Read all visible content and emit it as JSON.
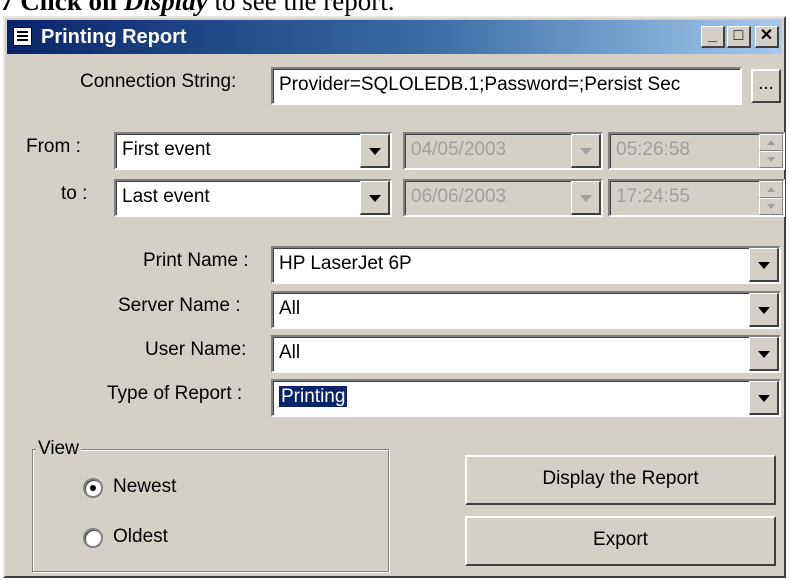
{
  "caption": {
    "prefix": "7 Click on",
    "emphasis": "Display",
    "suffix": "to see the report."
  },
  "window": {
    "title": "Printing Report",
    "minimize": "_",
    "maximize": "□",
    "close": "✕"
  },
  "connection": {
    "label": "Connection String:",
    "value": "Provider=SQLOLEDB.1;Password=;Persist Sec",
    "browse_label": "..."
  },
  "from": {
    "label": "From :",
    "event": "First event",
    "date": "04/05/2003",
    "time": "05:26:58"
  },
  "to": {
    "label": "to :",
    "event": "Last event",
    "date": "06/06/2003",
    "time": "17:24:55"
  },
  "print_name": {
    "label": "Print Name :",
    "value": "HP LaserJet 6P"
  },
  "server_name": {
    "label": "Server Name :",
    "value": "All"
  },
  "user_name": {
    "label": "User Name:",
    "value": "All"
  },
  "report_type": {
    "label": "Type of Report :",
    "value": "Printing"
  },
  "view": {
    "title": "View",
    "options": [
      {
        "label": "Newest",
        "selected": true
      },
      {
        "label": "Oldest",
        "selected": false
      }
    ]
  },
  "buttons": {
    "display": "Display the Report",
    "export": "Export"
  }
}
